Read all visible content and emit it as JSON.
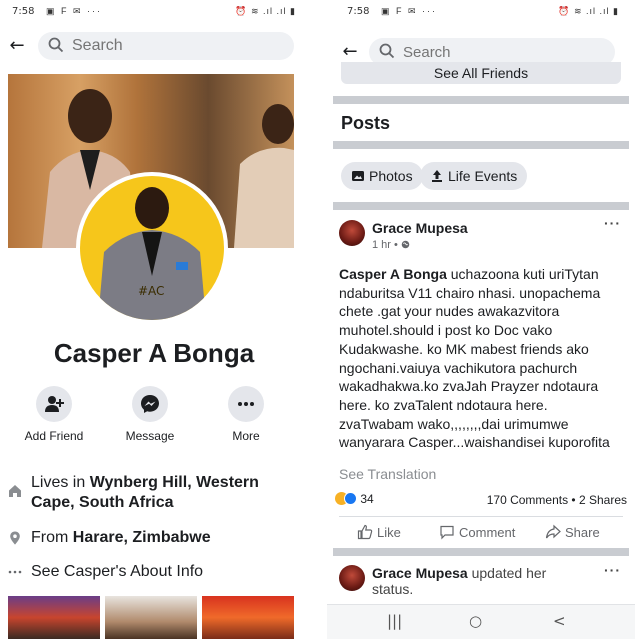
{
  "left": {
    "status": {
      "time": "7:58",
      "icons": "▣ F ✉ ···",
      "right_icons": "⏰ ≋ .ıl .ıl ▮"
    },
    "search": {
      "placeholder": "Search"
    },
    "profile": {
      "name": "Casper A Bonga",
      "avatar_tag": "#AC",
      "actions": [
        {
          "label": "Add Friend",
          "icon": "add-friend-icon"
        },
        {
          "label": "Message",
          "icon": "messenger-icon"
        },
        {
          "label": "More",
          "icon": "more-icon"
        }
      ],
      "lives": {
        "prefix": "Lives in ",
        "place": "Wynberg Hill, Western Cape, South Africa"
      },
      "from": {
        "prefix": "From ",
        "place": "Harare, Zimbabwe"
      },
      "about": "See Casper's About Info"
    }
  },
  "right": {
    "status": {
      "time": "7:58",
      "icons": "▣ F ✉ ···",
      "right_icons": "⏰ ≋ .ıl .ıl ▮"
    },
    "search": {
      "placeholder": "Search"
    },
    "see_all_friends": "See All Friends",
    "posts_heading": "Posts",
    "chips": [
      {
        "label": "Photos",
        "icon": "photos-icon"
      },
      {
        "label": "Life Events",
        "icon": "life-event-icon"
      }
    ],
    "post": {
      "author": "Grace Mupesa",
      "time": "1 hr •",
      "mention": "Casper A Bonga",
      "body": " uchazoona kuti uriTytan ndaburitsa V11 chairo nhasi. unopachema chete .gat your nudes awakazvitora muhotel.should i post ko Doc vako Kudakwashe. ko MK mabest friends ako ngochani.vaiuya vachikutora pachurch wakadhakwa.ko zvaJah Prayzer ndotaura here. ko zvaTalent ndotaura here. zvaTwabam wako,,,,,,,,dai urimumwe wanyarara Casper...waishandisei kuporofita",
      "see_translation": "See Translation",
      "reactions": "34",
      "counts": "170 Comments • 2 Shares",
      "actions": [
        "Like",
        "Comment",
        "Share"
      ],
      "more": "···"
    },
    "post2": {
      "author": "Grace Mupesa",
      "action": " updated her",
      "action2": "status.",
      "more": "···"
    },
    "navbar": {
      "recent": "|||",
      "home": "○",
      "back": "<"
    }
  },
  "colors": {
    "accent": "#1877f2",
    "avatar_bg": "#f6c61b",
    "separator": "#c9ccd1",
    "chip_bg": "#e4e6eb"
  }
}
